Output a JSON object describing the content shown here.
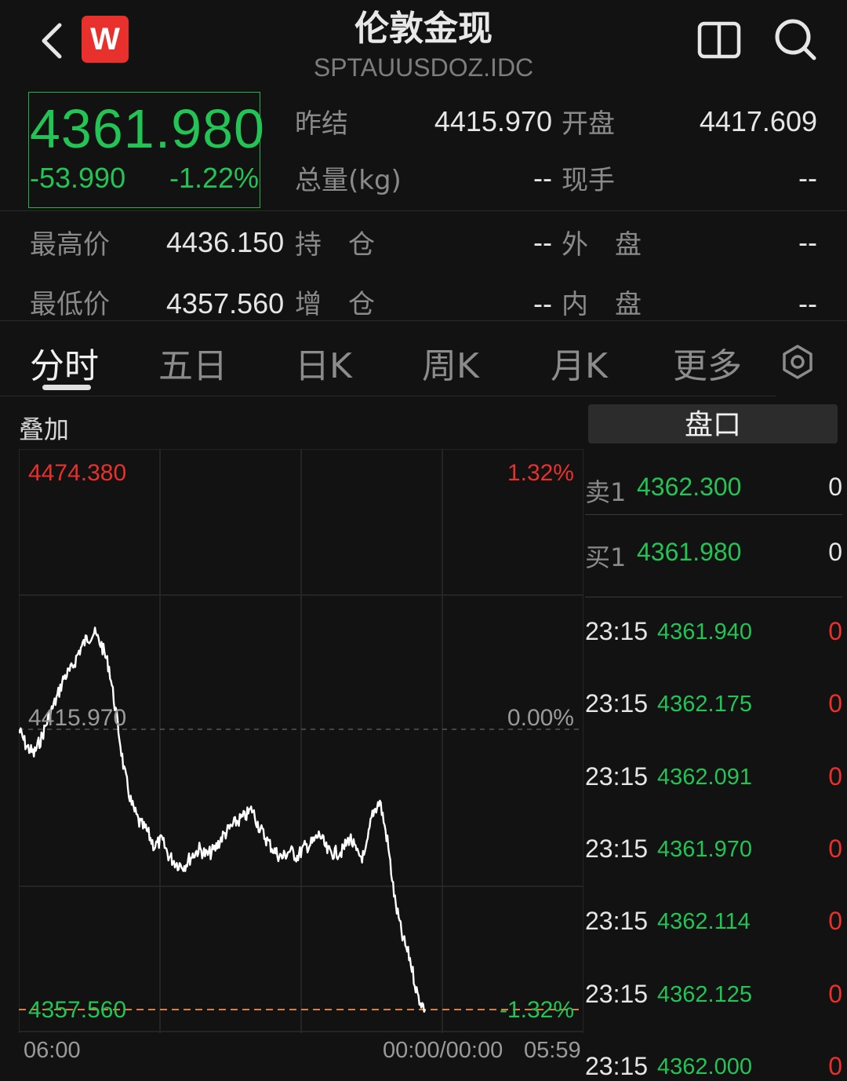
{
  "header": {
    "title": "伦敦金现",
    "code": "SPTAUUSDOZ.IDC",
    "logo_letter": "W"
  },
  "quote": {
    "last_price": "4361.980",
    "change": "-53.990",
    "change_pct": "-1.22%",
    "rows": [
      {
        "label1": "昨结",
        "value1": "4415.970",
        "label2": "开盘",
        "value2": "4417.609"
      },
      {
        "label1": "总量(kg)",
        "value1": "--",
        "label2": "现手",
        "value2": "--"
      },
      {
        "label1": "最高价",
        "value1": "4436.150",
        "label2": "持　仓",
        "value2": "--",
        "label3": "外　盘",
        "value3": "--"
      },
      {
        "label1": "最低价",
        "value1": "4357.560",
        "label2": "增　仓",
        "value2": "--",
        "label3": "内　盘",
        "value3": "--"
      }
    ]
  },
  "tabs": [
    "分时",
    "五日",
    "日K",
    "周K",
    "月K",
    "更多"
  ],
  "active_tab": 0,
  "chart": {
    "overlay_label": "叠加",
    "top_price": "4474.380",
    "top_pct": "1.32%",
    "mid_price": "4415.970",
    "mid_pct": "0.00%",
    "bottom_price": "4357.560",
    "bottom_pct": "-1.32%",
    "time_start": "06:00",
    "time_mid": "00:00/00:00",
    "time_end": "05:59"
  },
  "chart_data": {
    "type": "line",
    "xlabel": "",
    "ylabel": "",
    "x_ticks": [
      "06:00",
      "00:00/00:00",
      "05:59"
    ],
    "ylim": [
      4357.56,
      4474.38
    ],
    "reference": 4415.97,
    "series": [
      {
        "values": [
          4415.9,
          4412.5,
          4410.8,
          4414.2,
          4418.6,
          4422.3,
          4426.8,
          4428.4,
          4432.2,
          4434.8,
          4436.1,
          4433.5,
          4428.9,
          4418.5,
          4407.3,
          4400.2,
          4396.5,
          4394.8,
          4391.6,
          4392.8,
          4389.4,
          4388.0,
          4387.6,
          4389.6,
          4391.0,
          4389.7,
          4390.8,
          4393.5,
          4395.2,
          4396.8,
          4397.7,
          4399.3,
          4395.4,
          4392.8,
          4390.5,
          4389.2,
          4390.7,
          4389.5,
          4391.4,
          4392.2,
          4394.1,
          4390.5,
          4390.2,
          4390.6,
          4393.5,
          4389.8,
          4389.3,
          4398.5,
          4401.0,
          4392.7,
          4380.2,
          4372.6,
          4368.1,
          4360.5,
          4357.6
        ]
      }
    ]
  },
  "orderbook": {
    "button_label": "盘口",
    "levels": [
      {
        "label": "卖1",
        "price": "4362.300",
        "volume": "0"
      },
      {
        "label": "买1",
        "price": "4361.980",
        "volume": "0"
      }
    ],
    "ticks": [
      {
        "time": "23:15",
        "price": "4361.940",
        "volume": "0"
      },
      {
        "time": "23:15",
        "price": "4362.175",
        "volume": "0"
      },
      {
        "time": "23:15",
        "price": "4362.091",
        "volume": "0"
      },
      {
        "time": "23:15",
        "price": "4361.970",
        "volume": "0"
      },
      {
        "time": "23:15",
        "price": "4362.114",
        "volume": "0"
      },
      {
        "time": "23:15",
        "price": "4362.125",
        "volume": "0"
      },
      {
        "time": "23:15",
        "price": "4362.000",
        "volume": "0"
      }
    ]
  },
  "colors": {
    "down": "#23c355",
    "up": "#e8302c",
    "line": "#ffffff",
    "low_line": "#d9822b",
    "background": "#121212"
  },
  "icons": {
    "back": "chevron-left-icon",
    "layout": "split-view-icon",
    "search": "search-icon",
    "settings": "settings-icon"
  }
}
